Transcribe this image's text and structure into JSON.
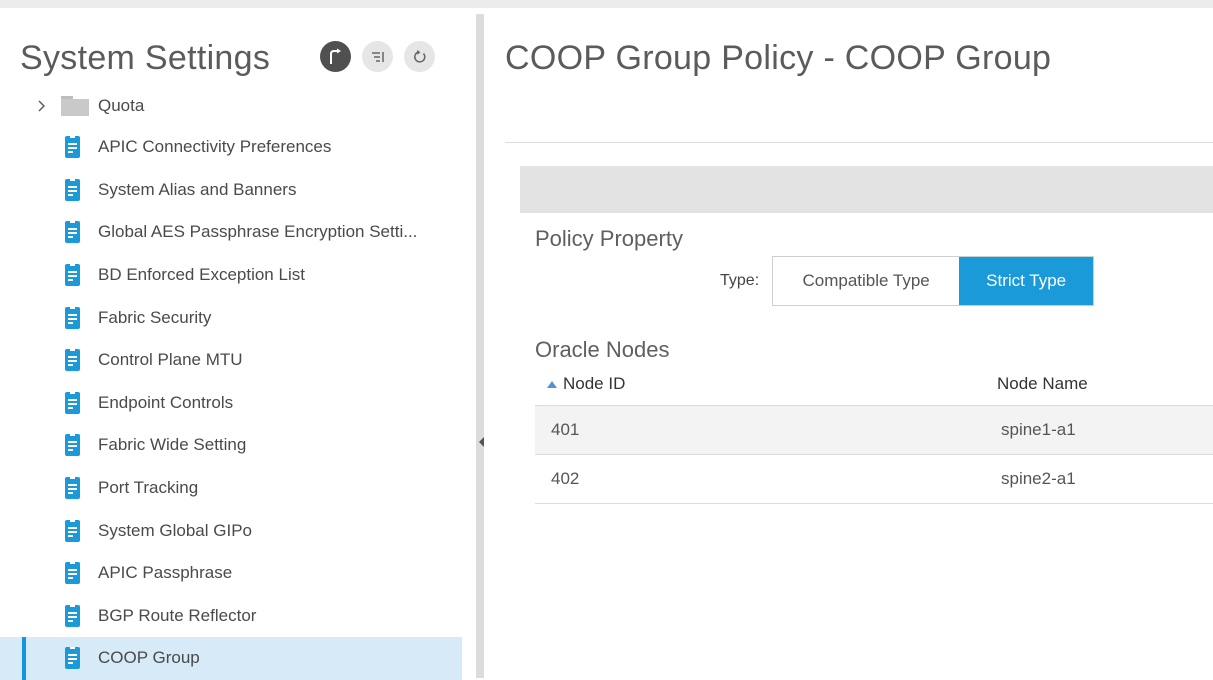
{
  "sidebar": {
    "title": "System Settings",
    "items": [
      {
        "label": "Quota"
      },
      {
        "label": "APIC Connectivity Preferences"
      },
      {
        "label": "System Alias and Banners"
      },
      {
        "label": "Global AES Passphrase Encryption Setti..."
      },
      {
        "label": "BD Enforced Exception List"
      },
      {
        "label": "Fabric Security"
      },
      {
        "label": "Control Plane MTU"
      },
      {
        "label": "Endpoint Controls"
      },
      {
        "label": "Fabric Wide Setting"
      },
      {
        "label": "Port Tracking"
      },
      {
        "label": "System Global GIPo"
      },
      {
        "label": "APIC Passphrase"
      },
      {
        "label": "BGP Route Reflector"
      },
      {
        "label": "COOP Group"
      }
    ]
  },
  "main": {
    "title": "COOP Group Policy - COOP Group",
    "policy_property": {
      "heading": "Policy Property",
      "type_label": "Type:",
      "options": [
        "Compatible Type",
        "Strict Type"
      ],
      "selected": "Strict Type"
    },
    "oracle_nodes": {
      "heading": "Oracle Nodes",
      "columns": [
        "Node ID",
        "Node Name"
      ],
      "rows": [
        [
          "401",
          "spine1-a1"
        ],
        [
          "402",
          "spine2-a1"
        ]
      ]
    }
  },
  "colors": {
    "accent": "#1a9ad9",
    "selected_row": "#d6eaf8"
  }
}
